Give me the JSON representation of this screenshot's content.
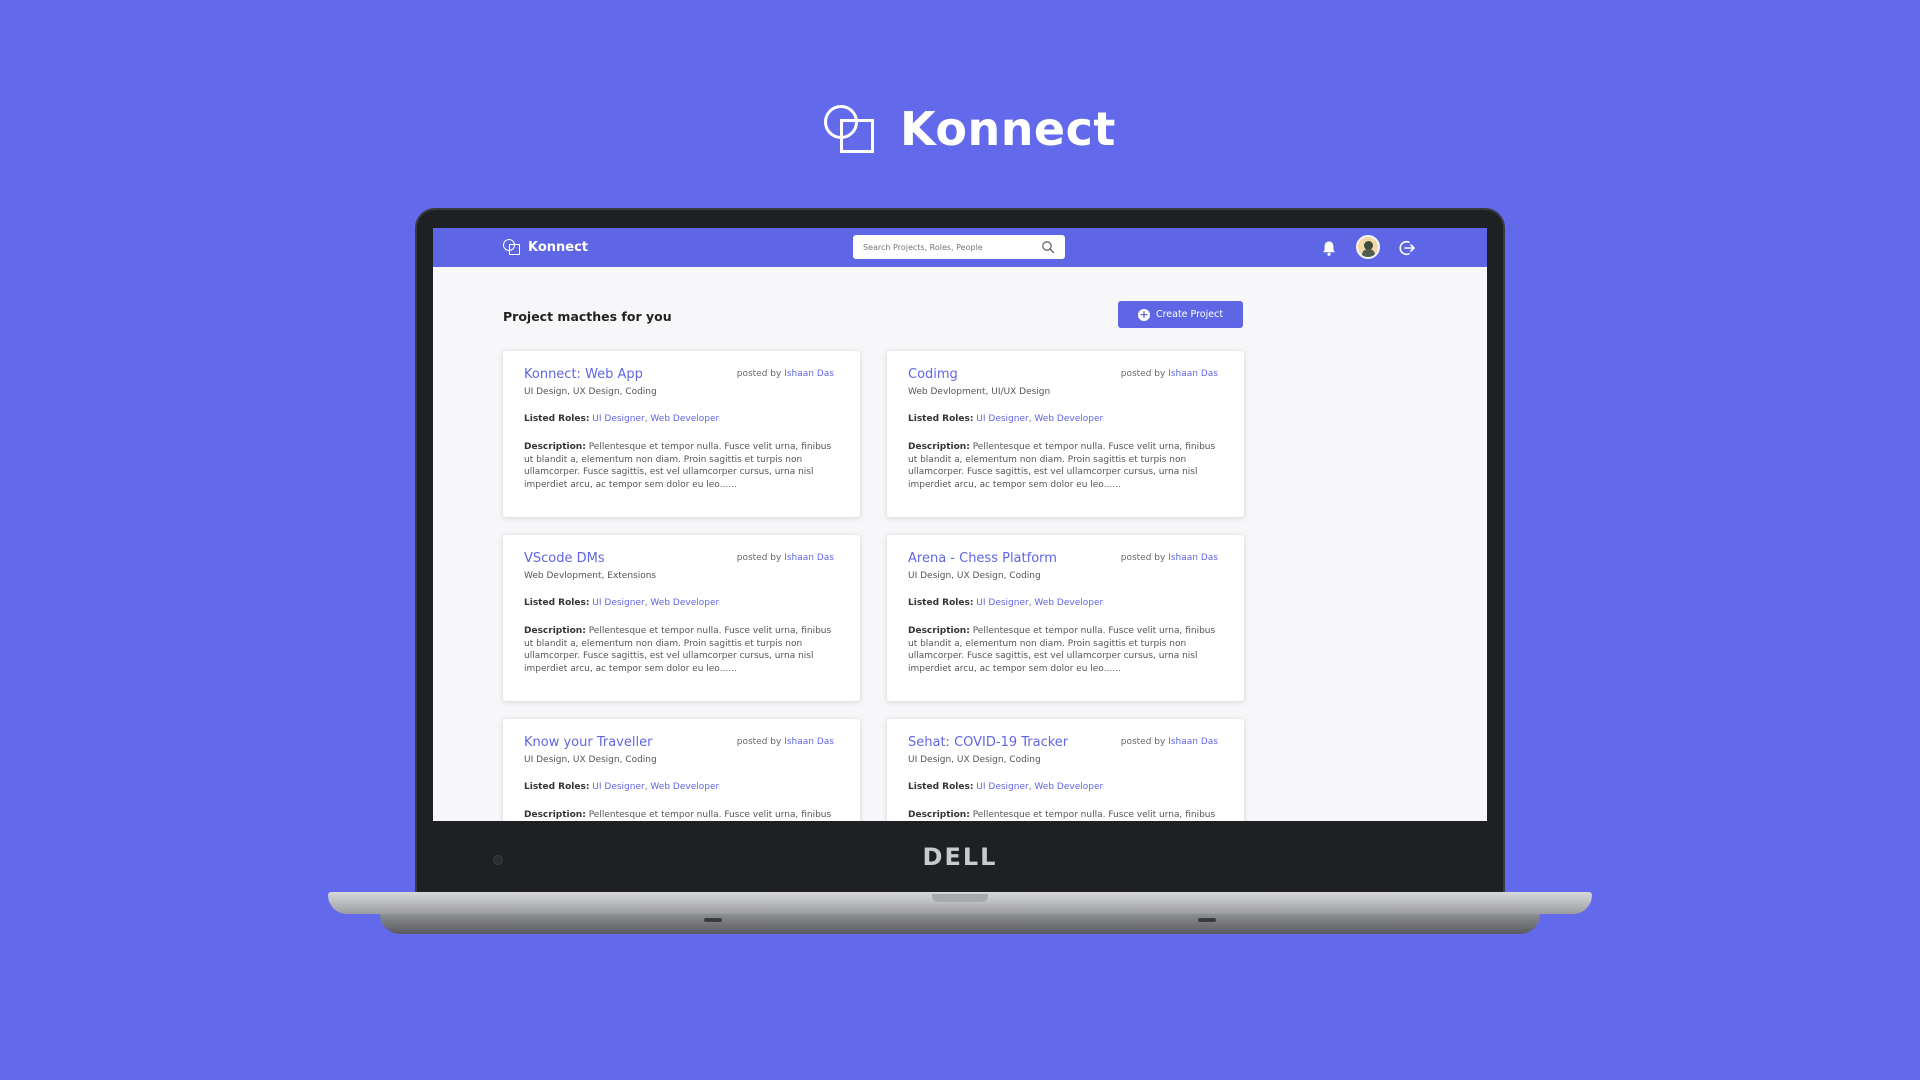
{
  "hero": {
    "title": "Konnect"
  },
  "device": {
    "brand": "DELL"
  },
  "navbar": {
    "title": "Konnect",
    "search_placeholder": "Search Projects, Roles, People"
  },
  "main": {
    "section_title": "Project macthes for you",
    "create_button": "Create Project"
  },
  "labels": {
    "posted_by": "posted by",
    "listed_roles": "Listed Roles:",
    "description": "Description:"
  },
  "projects": [
    {
      "title": "Konnect: Web App",
      "author": "Ishaan Das",
      "tags": "UI Design, UX Design, Coding",
      "roles": "UI Designer, Web Developer",
      "description": "Pellentesque et tempor nulla. Fusce velit urna, finibus ut blandit a, elementum non diam. Proin sagittis et turpis non ullamcorper. Fusce sagittis, est vel ullamcorper cursus, urna nisl imperdiet arcu, ac tempor sem dolor eu leo......"
    },
    {
      "title": "Codimg",
      "author": "Ishaan Das",
      "tags": "Web Devlopment, UI/UX Design",
      "roles": "UI Designer, Web Developer",
      "description": "Pellentesque et tempor nulla. Fusce velit urna, finibus ut blandit a, elementum non diam. Proin sagittis et turpis non ullamcorper. Fusce sagittis, est vel ullamcorper cursus, urna nisl imperdiet arcu, ac tempor sem dolor eu leo......"
    },
    {
      "title": "VScode DMs",
      "author": "Ishaan Das",
      "tags": "Web Devlopment, Extensions",
      "roles": "UI Designer, Web Developer",
      "description": "Pellentesque et tempor nulla. Fusce velit urna, finibus ut blandit a, elementum non diam. Proin sagittis et turpis non ullamcorper. Fusce sagittis, est vel ullamcorper cursus, urna nisl imperdiet arcu, ac tempor sem dolor eu leo......"
    },
    {
      "title": "Arena - Chess Platform",
      "author": "Ishaan Das",
      "tags": "UI Design, UX Design, Coding",
      "roles": "UI Designer, Web Developer",
      "description": "Pellentesque et tempor nulla. Fusce velit urna, finibus ut blandit a, elementum non diam. Proin sagittis et turpis non ullamcorper. Fusce sagittis, est vel ullamcorper cursus, urna nisl imperdiet arcu, ac tempor sem dolor eu leo......"
    },
    {
      "title": "Know your Traveller",
      "author": "Ishaan Das",
      "tags": "UI Design, UX Design, Coding",
      "roles": "UI Designer, Web Developer",
      "description": "Pellentesque et tempor nulla. Fusce velit urna, finibus"
    },
    {
      "title": "Sehat: COVID-19 Tracker",
      "author": "Ishaan Das",
      "tags": "UI Design, UX Design, Coding",
      "roles": "UI Designer, Web Developer",
      "description": "Pellentesque et tempor nulla. Fusce velit urna, finibus"
    }
  ]
}
